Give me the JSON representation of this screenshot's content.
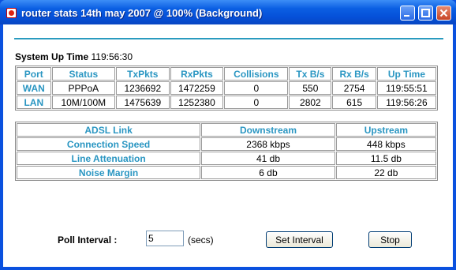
{
  "window": {
    "title": "router stats 14th may 2007 @ 100% (Background)",
    "icon": "app-icon"
  },
  "system": {
    "label": "System Up Time",
    "value": "119:56:30"
  },
  "stats_table": {
    "headers": [
      "Port",
      "Status",
      "TxPkts",
      "RxPkts",
      "Collisions",
      "Tx B/s",
      "Rx B/s",
      "Up Time"
    ],
    "rows": [
      [
        "WAN",
        "PPPoA",
        "1236692",
        "1472259",
        "0",
        "550",
        "2754",
        "119:55:51"
      ],
      [
        "LAN",
        "10M/100M",
        "1475639",
        "1252380",
        "0",
        "2802",
        "615",
        "119:56:26"
      ]
    ]
  },
  "adsl_table": {
    "headers": [
      "ADSL Link",
      "Downstream",
      "Upstream"
    ],
    "rows": [
      [
        "Connection Speed",
        "2368 kbps",
        "448 kbps"
      ],
      [
        "Line Attenuation",
        "41 db",
        "11.5 db"
      ],
      [
        "Noise Margin",
        "6 db",
        "22 db"
      ]
    ]
  },
  "poll": {
    "label": "Poll Interval :",
    "value": "5",
    "units": "(secs)"
  },
  "buttons": {
    "set_interval": "Set Interval",
    "stop": "Stop"
  },
  "colors": {
    "accent": "#2a96c2",
    "titlebar": "#0b5fe3"
  }
}
